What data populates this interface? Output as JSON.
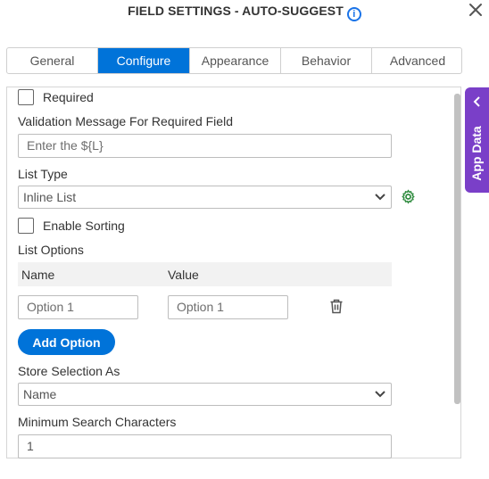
{
  "header": {
    "title": "FIELD SETTINGS - AUTO-SUGGEST",
    "info_icon": "info-icon",
    "close_icon": "close-icon"
  },
  "tabs": [
    {
      "label": "General",
      "active": false
    },
    {
      "label": "Configure",
      "active": true
    },
    {
      "label": "Appearance",
      "active": false
    },
    {
      "label": "Behavior",
      "active": false
    },
    {
      "label": "Advanced",
      "active": false
    }
  ],
  "form": {
    "required_label": "Required",
    "validation_label": "Validation Message For Required Field",
    "validation_placeholder": "Enter the ${L}",
    "list_type_label": "List Type",
    "list_type_value": "Inline List",
    "enable_sorting_label": "Enable Sorting",
    "list_options_label": "List Options",
    "table": {
      "col_name": "Name",
      "col_value": "Value",
      "rows": [
        {
          "name": "Option 1",
          "value": "Option 1"
        }
      ]
    },
    "add_option_label": "Add Option",
    "store_selection_label": "Store Selection As",
    "store_selection_value": "Name",
    "min_search_label": "Minimum Search Characters",
    "min_search_value": "1"
  },
  "side_panel": {
    "label": "App Data"
  },
  "colors": {
    "accent": "#0073d9",
    "side_panel": "#7a3fc8",
    "gear": "#2e8b3e"
  }
}
